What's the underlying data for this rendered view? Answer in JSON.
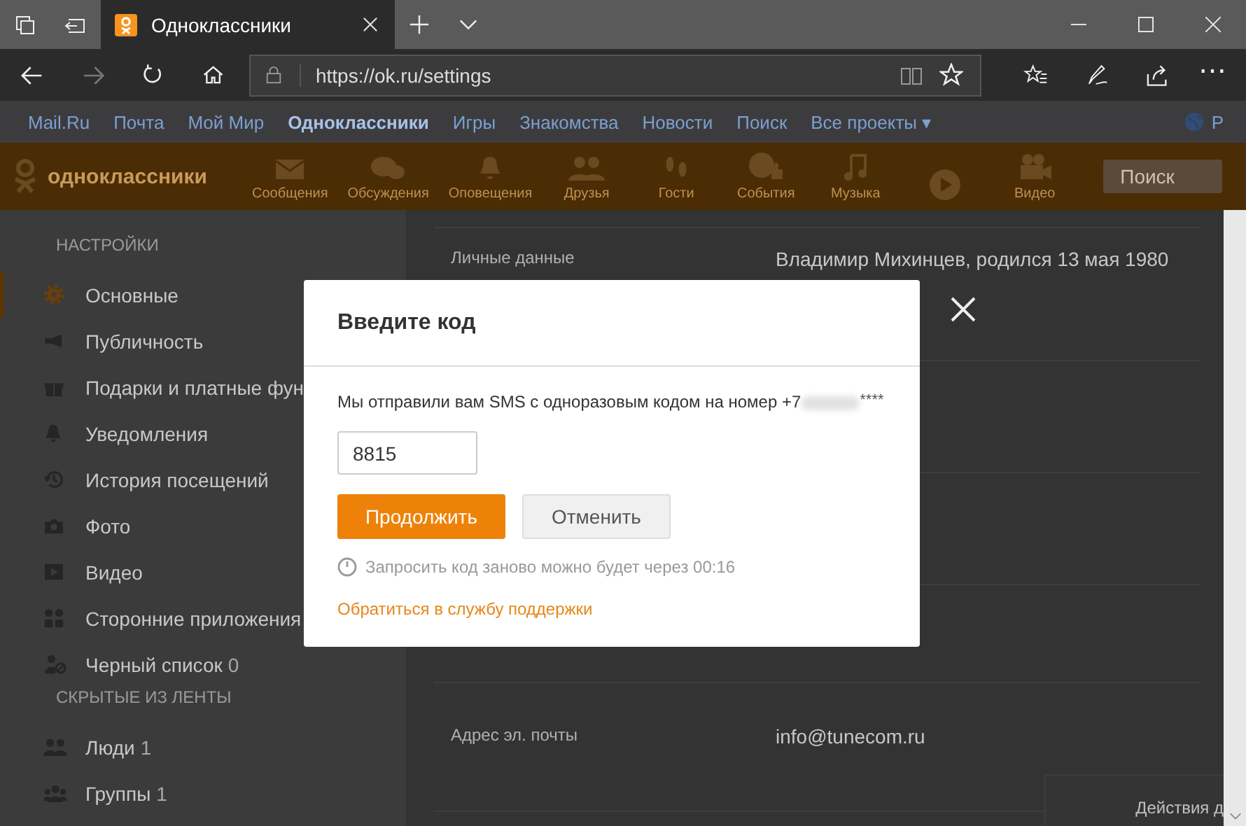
{
  "browser": {
    "tabs": [
      {
        "title": "Одноклассники",
        "selected": true
      }
    ],
    "address": {
      "url": "https://ok.ru/settings"
    },
    "more_button": "⋯"
  },
  "portal_nav": {
    "items": [
      {
        "label": "Mail.Ru",
        "selected": false
      },
      {
        "label": "Почта",
        "selected": false
      },
      {
        "label": "Мой Мир",
        "selected": false
      },
      {
        "label": "Одноклассники",
        "selected": true
      },
      {
        "label": "Игры",
        "selected": false
      },
      {
        "label": "Знакомства",
        "selected": false
      },
      {
        "label": "Новости",
        "selected": false
      },
      {
        "label": "Поиск",
        "selected": false
      },
      {
        "label": "Все проекты ▾",
        "selected": false
      }
    ],
    "language": "Р"
  },
  "ok_header": {
    "logo_text": "одноклассники",
    "nav": [
      {
        "kind": "envelope",
        "label": "Сообщения"
      },
      {
        "kind": "chat",
        "label": "Обсуждения"
      },
      {
        "kind": "bell",
        "label": "Оповещения"
      },
      {
        "kind": "friends",
        "label": "Друзья"
      },
      {
        "kind": "footprints",
        "label": "Гости"
      },
      {
        "kind": "events",
        "label": "События"
      },
      {
        "kind": "music",
        "label": "Музыка"
      },
      {
        "kind": "play"
      },
      {
        "kind": "camera",
        "label": "Видео"
      }
    ],
    "search": {
      "placeholder": "Поиск"
    }
  },
  "sidebar": {
    "sections": [
      {
        "heading": "НАСТРОЙКИ",
        "items": [
          {
            "kind": "gear",
            "label": "Основные",
            "selected": true
          },
          {
            "kind": "megaphone",
            "label": "Публичность",
            "selected": false
          },
          {
            "kind": "gift",
            "label": "Подарки и платные фун",
            "selected": false
          },
          {
            "kind": "bell",
            "label": "Уведомления",
            "selected": false
          },
          {
            "kind": "history",
            "label": "История посещений",
            "selected": false
          },
          {
            "kind": "camera",
            "label": "Фото",
            "selected": false
          },
          {
            "kind": "video",
            "label": "Видео",
            "selected": false
          },
          {
            "kind": "apps",
            "label": "Сторонние приложения",
            "selected": false
          },
          {
            "kind": "block",
            "label": "Черный список",
            "count": "0",
            "selected": false
          }
        ]
      },
      {
        "heading": "СКРЫТЫЕ ИЗ ЛЕНТЫ",
        "items": [
          {
            "kind": "people",
            "label": "Люди",
            "count": "1",
            "selected": false
          },
          {
            "kind": "groups",
            "label": "Группы",
            "count": "1",
            "selected": false
          }
        ]
      }
    ]
  },
  "main": {
    "rows": [
      {
        "label": "Личные данные",
        "value": "Владимир Михинцев, родился 13 мая 1980"
      },
      {},
      {},
      {},
      {
        "label": "Адрес эл. почты",
        "value": "info@tunecom.ru"
      }
    ],
    "actions_button": "Действия д"
  },
  "dialog": {
    "title": "Введите код",
    "message": "Мы отправили вам SMS с одноразовым кодом на номер +7",
    "masked": "****",
    "code": "8815",
    "buttons": [
      {
        "kind": "primary",
        "label": "Продолжить"
      },
      {
        "kind": "secondary",
        "label": "Отменить"
      }
    ],
    "timer": "Запросить код заново можно будет через 00:16",
    "support_link": "Обратиться в службу поддержки"
  }
}
